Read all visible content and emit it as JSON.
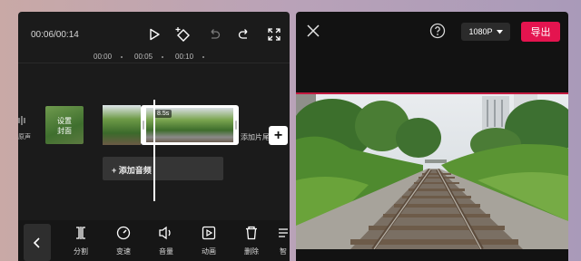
{
  "editor": {
    "time": "00:06/00:14",
    "ruler": [
      "00:00",
      "00:05",
      "00:10"
    ],
    "audio_label": "原声",
    "cover_label_line1": "设置",
    "cover_label_line2": "封面",
    "clip_duration": "8.5s",
    "add_clip_label": "添加片尾",
    "add_audio_label": "添加音频",
    "toolbar": [
      {
        "label": "分割",
        "icon": "split-icon"
      },
      {
        "label": "变速",
        "icon": "speed-icon"
      },
      {
        "label": "音量",
        "icon": "volume-icon"
      },
      {
        "label": "动画",
        "icon": "animation-icon"
      },
      {
        "label": "删除",
        "icon": "delete-icon"
      },
      {
        "label": "智",
        "icon": "smart-icon"
      }
    ]
  },
  "export_panel": {
    "resolution": "1080P",
    "export_label": "导出"
  },
  "colors": {
    "accent": "#e4144f",
    "panel_bg": "#1b1b1b"
  }
}
